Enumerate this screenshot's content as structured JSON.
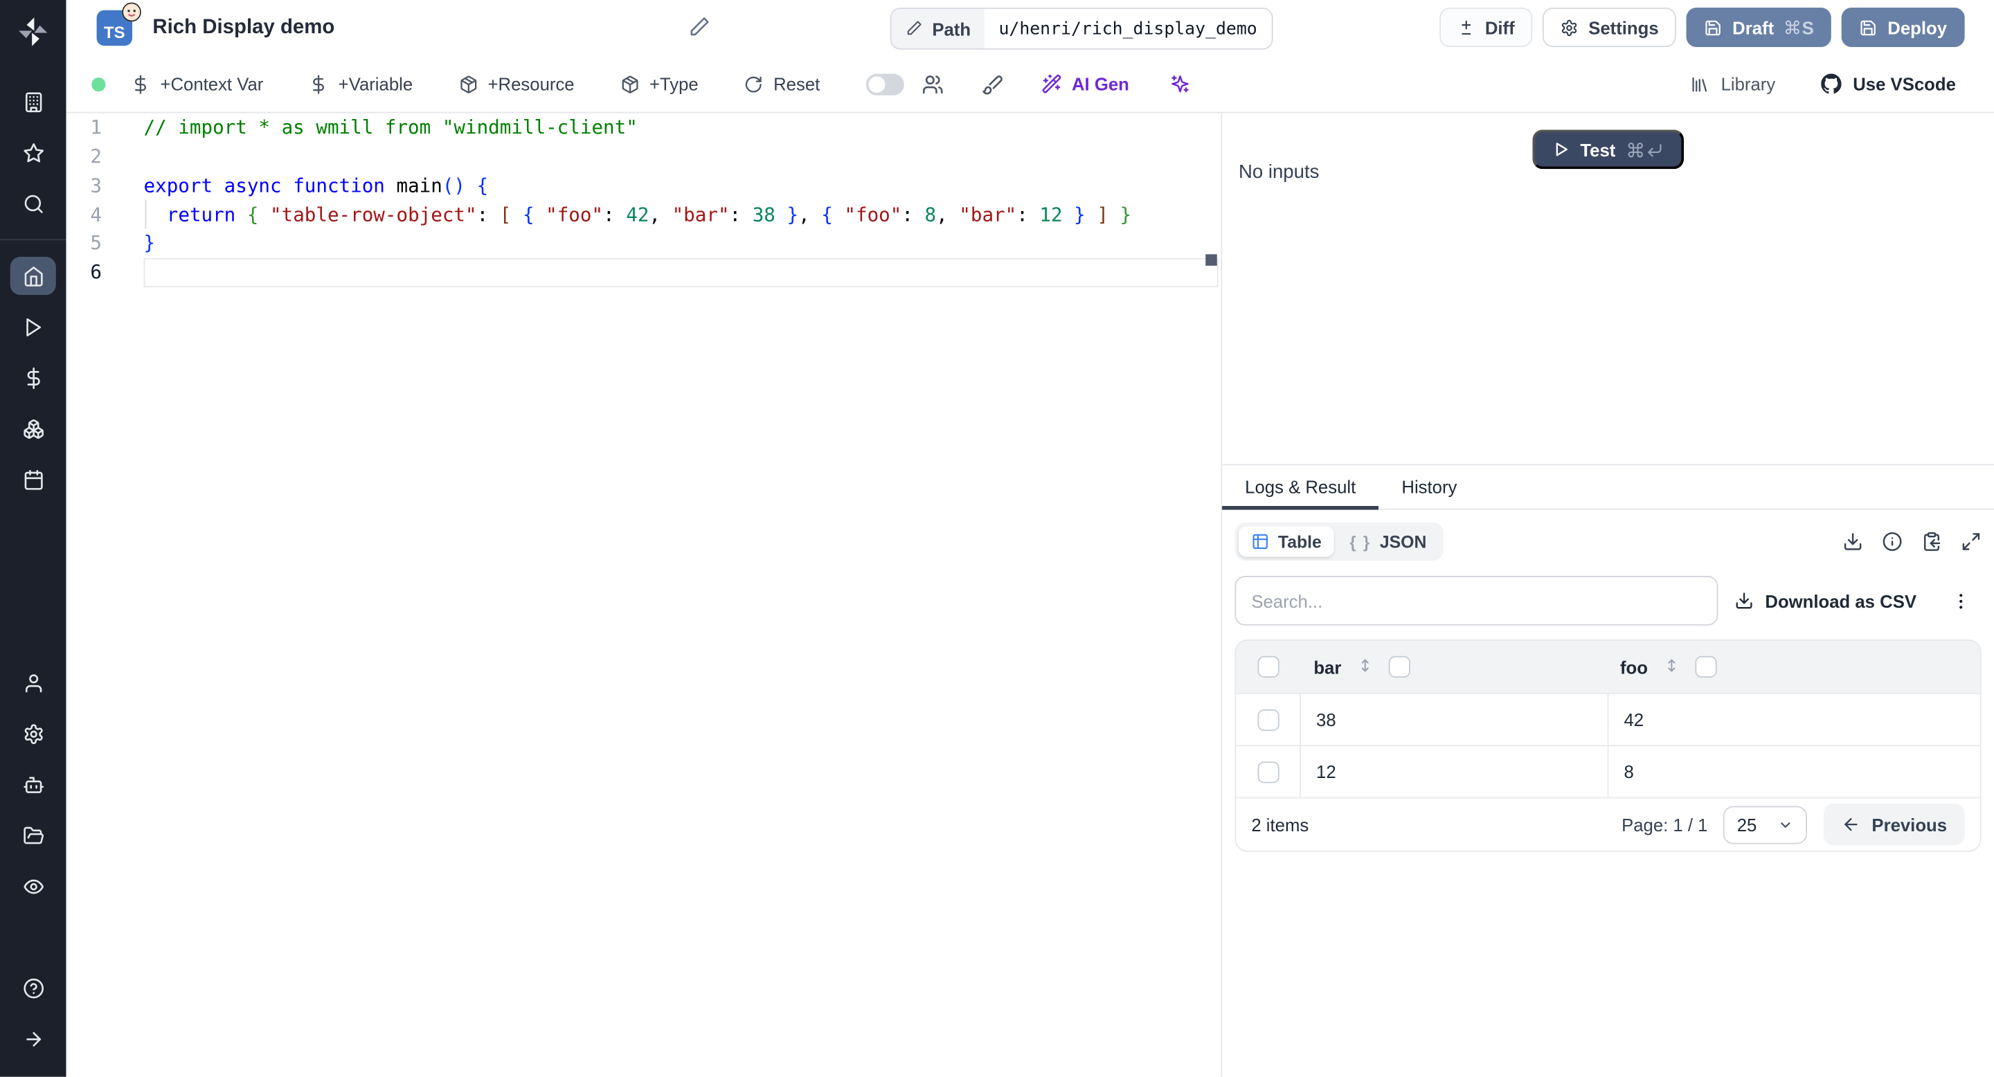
{
  "colors": {
    "sidebar_bg": "#1b202a",
    "sidebar_active": "#49586f",
    "accent_slate": "#6880a6",
    "test_navy": "#3b4864",
    "ai_purple": "#6d28d9",
    "ts_blue": "#4178c8",
    "status_green": "#6ee09e",
    "table_blue": "#3b82f6"
  },
  "sidebar": {
    "logo": "windmill-logo",
    "top_icons": [
      "building",
      "star",
      "search"
    ],
    "middle_icons": [
      "home",
      "play",
      "dollar",
      "boxes",
      "calendar"
    ],
    "lower_icons": [
      "user",
      "settings",
      "bot",
      "folder-open",
      "eye"
    ],
    "footer_icons": [
      "help",
      "arrow-right"
    ],
    "active": "home"
  },
  "header": {
    "language_badge": "TS",
    "title": "Rich Display demo",
    "path_label": "Path",
    "path_value": "u/henri/rich_display_demo",
    "diff_label": "Diff",
    "settings_label": "Settings",
    "draft_label": "Draft",
    "draft_shortcut_key": "S",
    "deploy_label": "Deploy"
  },
  "toolbar": {
    "items": [
      {
        "icon": "dollar",
        "label": "+Context Var"
      },
      {
        "icon": "dollar",
        "label": "+Variable"
      },
      {
        "icon": "package",
        "label": "+Resource"
      },
      {
        "icon": "package",
        "label": "+Type"
      },
      {
        "icon": "reset",
        "label": "Reset"
      }
    ],
    "ai_gen_label": "AI Gen",
    "library_label": "Library",
    "vscode_label": "Use VScode"
  },
  "editor": {
    "active_line": 6,
    "lines": [
      {
        "num": 1,
        "tokens": [
          [
            "// import * as wmill from \"windmill-client\"",
            "c"
          ]
        ]
      },
      {
        "num": 2,
        "tokens": []
      },
      {
        "num": 3,
        "tokens": [
          [
            "export",
            "k"
          ],
          [
            " ",
            "p"
          ],
          [
            "async",
            "k"
          ],
          [
            " ",
            "p"
          ],
          [
            "function",
            "k"
          ],
          [
            " ",
            "p"
          ],
          [
            "main",
            "f"
          ],
          [
            "(",
            "b1"
          ],
          [
            ")",
            "b1"
          ],
          [
            " ",
            "p"
          ],
          [
            "{",
            "b1"
          ]
        ]
      },
      {
        "num": 4,
        "tokens": [
          [
            "  ",
            "p"
          ],
          [
            "return",
            "k"
          ],
          [
            " ",
            "p"
          ],
          [
            "{",
            "b2"
          ],
          [
            " ",
            "p"
          ],
          [
            "\"table-row-object\"",
            "s"
          ],
          [
            ": ",
            "p"
          ],
          [
            "[",
            "b3"
          ],
          [
            " ",
            "p"
          ],
          [
            "{",
            "b1"
          ],
          [
            " ",
            "p"
          ],
          [
            "\"foo\"",
            "s"
          ],
          [
            ": ",
            "p"
          ],
          [
            "42",
            "n"
          ],
          [
            ", ",
            "p"
          ],
          [
            "\"bar\"",
            "s"
          ],
          [
            ": ",
            "p"
          ],
          [
            "38",
            "n"
          ],
          [
            " ",
            "p"
          ],
          [
            "}",
            "b1"
          ],
          [
            ", ",
            "p"
          ],
          [
            "{",
            "b1"
          ],
          [
            " ",
            "p"
          ],
          [
            "\"foo\"",
            "s"
          ],
          [
            ": ",
            "p"
          ],
          [
            "8",
            "n"
          ],
          [
            ", ",
            "p"
          ],
          [
            "\"bar\"",
            "s"
          ],
          [
            ": ",
            "p"
          ],
          [
            "12",
            "n"
          ],
          [
            " ",
            "p"
          ],
          [
            "}",
            "b1"
          ],
          [
            " ",
            "p"
          ],
          [
            "]",
            "b3"
          ],
          [
            " ",
            "p"
          ],
          [
            "}",
            "b2"
          ]
        ]
      },
      {
        "num": 5,
        "tokens": [
          [
            "}",
            "b1"
          ]
        ]
      },
      {
        "num": 6,
        "tokens": []
      }
    ]
  },
  "run_panel": {
    "test_label": "Test",
    "no_inputs": "No inputs"
  },
  "result_panel": {
    "tabs": [
      "Logs & Result",
      "History"
    ],
    "active_tab": "Logs & Result",
    "view_options": [
      "Table",
      "JSON"
    ],
    "selected_view": "Table",
    "action_icons": [
      "download",
      "info",
      "clipboard-copy",
      "maximize"
    ],
    "search_placeholder": "Search...",
    "download_csv_label": "Download as CSV",
    "chart_data": {
      "type": "table",
      "columns": [
        "bar",
        "foo"
      ],
      "rows": [
        [
          "38",
          "42"
        ],
        [
          "12",
          "8"
        ]
      ]
    },
    "footer": {
      "items_label": "2 items",
      "page_label": "Page: 1 / 1",
      "page_size": "25",
      "previous_label": "Previous"
    }
  }
}
